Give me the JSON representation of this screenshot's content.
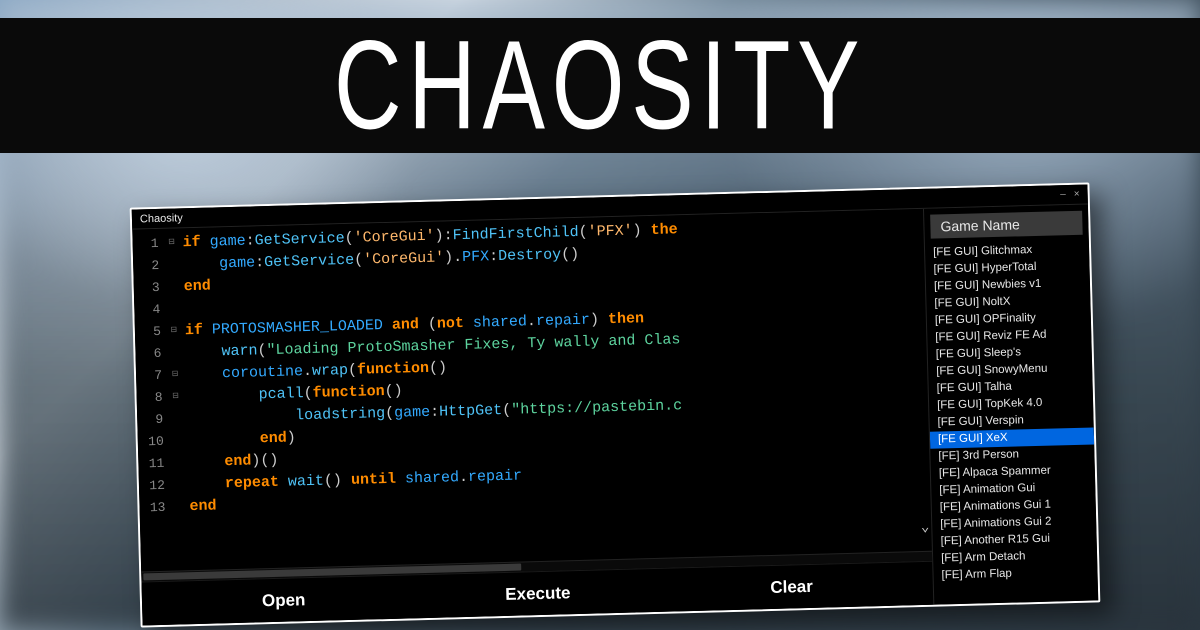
{
  "banner": {
    "title": "CHAOSITY"
  },
  "window": {
    "title": "Chaosity",
    "controls": {
      "minimize": "–",
      "close": "×"
    }
  },
  "sidebar": {
    "header": "Game Name",
    "selected_index": 11,
    "items": [
      "[FE GUI] Glitchmax",
      "[FE GUI] HyperTotal",
      "[FE GUI] Newbies v1",
      "[FE GUI] NoltX",
      "[FE GUI] OPFinality",
      "[FE GUI] Reviz FE Ad",
      "[FE GUI] Sleep's",
      "[FE GUI] SnowyMenu",
      "[FE GUI] Talha",
      "[FE GUI] TopKek 4.0",
      "[FE GUI] Verspin",
      "[FE GUI] XeX",
      "[FE] 3rd Person",
      "[FE] Alpaca Spammer",
      "[FE] Animation Gui",
      "[FE] Animations Gui 1",
      "[FE] Animations Gui 2",
      "[FE] Another R15 Gui",
      "[FE] Arm Detach",
      "[FE] Arm Flap"
    ]
  },
  "buttons": {
    "open": "Open",
    "execute": "Execute",
    "clear": "Clear"
  },
  "code": {
    "lines": [
      {
        "n": 1,
        "fold": "⊟",
        "html": "<span class='kw'>if</span> <span class='ident'>game</span><span class='punct'>:</span><span class='fn'>GetService</span><span class='punct'>(</span><span class='str'>'CoreGui'</span><span class='punct'>):</span><span class='fn'>FindFirstChild</span><span class='punct'>(</span><span class='str'>'PFX'</span><span class='punct'>)</span> <span class='kw'>the</span>"
      },
      {
        "n": 2,
        "fold": "",
        "html": "    <span class='ident'>game</span><span class='punct'>:</span><span class='fn'>GetService</span><span class='punct'>(</span><span class='str'>'CoreGui'</span><span class='punct'>).</span><span class='ident'>PFX</span><span class='punct'>:</span><span class='fn'>Destroy</span><span class='punct'>()</span>"
      },
      {
        "n": 3,
        "fold": "",
        "html": "<span class='kw'>end</span>"
      },
      {
        "n": 4,
        "fold": "",
        "html": ""
      },
      {
        "n": 5,
        "fold": "⊟",
        "html": "<span class='kw'>if</span> <span class='ident'>PROTOSMASHER_LOADED</span> <span class='kw'>and</span> <span class='punct'>(</span><span class='kw'>not</span> <span class='ident'>shared</span><span class='punct'>.</span><span class='ident'>repair</span><span class='punct'>)</span> <span class='kw'>then</span>"
      },
      {
        "n": 6,
        "fold": "",
        "html": "    <span class='fn'>warn</span><span class='punct'>(</span><span class='str2'>\"Loading ProtoSmasher Fixes, Ty wally and Clas</span>"
      },
      {
        "n": 7,
        "fold": "⊟",
        "html": "    <span class='ident'>coroutine</span><span class='punct'>.</span><span class='fn'>wrap</span><span class='punct'>(</span><span class='kw'>function</span><span class='punct'>()</span>"
      },
      {
        "n": 8,
        "fold": "⊟",
        "html": "        <span class='fn'>pcall</span><span class='punct'>(</span><span class='kw'>function</span><span class='punct'>()</span>"
      },
      {
        "n": 9,
        "fold": "",
        "html": "            <span class='fn'>loadstring</span><span class='punct'>(</span><span class='ident'>game</span><span class='punct'>:</span><span class='fn'>HttpGet</span><span class='punct'>(</span><span class='str2'>\"https://pastebin.c</span>"
      },
      {
        "n": 10,
        "fold": "",
        "html": "        <span class='kw'>end</span><span class='punct'>)</span>"
      },
      {
        "n": 11,
        "fold": "",
        "html": "    <span class='kw'>end</span><span class='punct'>)()</span>"
      },
      {
        "n": 12,
        "fold": "",
        "html": "    <span class='kw'>repeat</span> <span class='fn'>wait</span><span class='punct'>()</span> <span class='kw'>until</span> <span class='ident'>shared</span><span class='punct'>.</span><span class='ident'>repair</span>"
      },
      {
        "n": 13,
        "fold": "",
        "html": "<span class='kw'>end</span>"
      }
    ]
  }
}
